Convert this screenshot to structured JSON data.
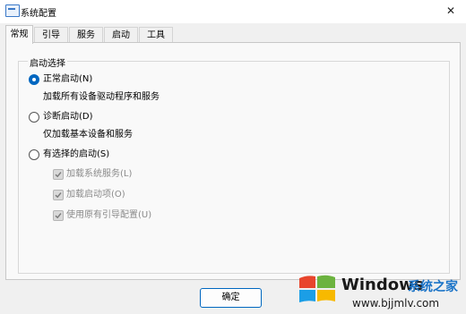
{
  "window": {
    "title": "系统配置",
    "close_glyph": "✕"
  },
  "tabs": [
    {
      "label": "常规",
      "active": true
    },
    {
      "label": "引导",
      "active": false
    },
    {
      "label": "服务",
      "active": false
    },
    {
      "label": "启动",
      "active": false
    },
    {
      "label": "工具",
      "active": false
    }
  ],
  "startup_selection": {
    "legend": "启动选择",
    "normal": {
      "label": "正常启动(N)",
      "description": "加载所有设备驱动程序和服务",
      "selected": true
    },
    "diagnostic": {
      "label": "诊断启动(D)",
      "description": "仅加载基本设备和服务",
      "selected": false
    },
    "selective": {
      "label": "有选择的启动(S)",
      "selected": false,
      "options": [
        {
          "label": "加载系统服务(L)",
          "checked": true,
          "enabled": false
        },
        {
          "label": "加载启动项(O)",
          "checked": true,
          "enabled": false
        },
        {
          "label": "使用原有引导配置(U)",
          "checked": true,
          "enabled": false
        }
      ]
    }
  },
  "buttons": {
    "ok": "确定"
  },
  "watermark": {
    "brand": "Windows",
    "site_name": "系统之家",
    "url": "www.bjjmlv.com"
  },
  "colors": {
    "accent": "#0067c0",
    "disabled_text": "#8a8a8a"
  }
}
